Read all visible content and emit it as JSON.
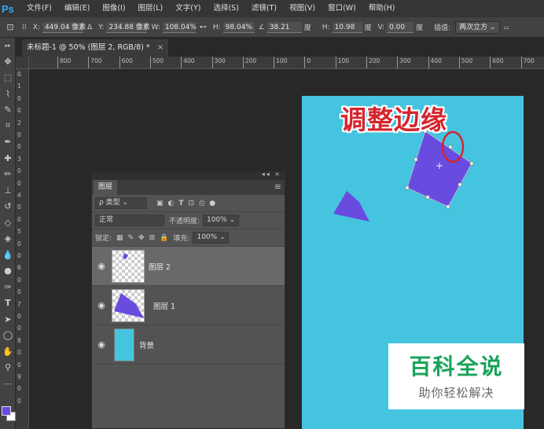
{
  "app": {
    "logo": "Ps"
  },
  "menu": [
    "文件(F)",
    "编辑(E)",
    "图像(I)",
    "图层(L)",
    "文字(Y)",
    "选择(S)",
    "滤镜(T)",
    "视图(V)",
    "窗口(W)",
    "帮助(H)"
  ],
  "options": {
    "x_label": "X:",
    "x_value": "449.04 像素",
    "y_label": "Y:",
    "y_value": "234.88 像素",
    "w_label": "W:",
    "w_value": "108.04%",
    "h_label": "H:",
    "h_value": "98.04%",
    "angle_value": "38.21",
    "angle_unit": "度",
    "hskew_label": "H:",
    "hskew_value": "10.98",
    "hskew_unit": "度",
    "vskew_label": "V:",
    "vskew_value": "0.00",
    "vskew_unit": "度",
    "interp_label": "插值:",
    "interp_value": "两次立方"
  },
  "document_tab": {
    "title": "未标题-1 @ 50% (图层 2, RGB/8) *",
    "close": "×"
  },
  "ruler_h": [
    "800",
    "700",
    "600",
    "500",
    "400",
    "300",
    "200",
    "100",
    "0",
    "100",
    "200",
    "300",
    "400",
    "500",
    "600",
    "700"
  ],
  "ruler_v": [
    "0",
    "1",
    "0",
    "0",
    "2",
    "0",
    "0",
    "3",
    "0",
    "0",
    "4",
    "0",
    "0",
    "5",
    "0",
    "0",
    "6",
    "0",
    "0",
    "7",
    "0",
    "0",
    "8",
    "0",
    "0",
    "9",
    "0",
    "0"
  ],
  "overlay": {
    "title": "调整边缘"
  },
  "watermark": {
    "brand": "百科全说",
    "slogan": "助你轻松解决"
  },
  "layers_panel": {
    "collapse": "◂◂ ×",
    "tab": "图层",
    "menu_icon": "≡",
    "filter_kind": "ρ 类型",
    "blend_mode": "正常",
    "opacity_label": "不透明度:",
    "opacity_value": "100%",
    "lock_label": "锁定:",
    "fill_label": "填充:",
    "fill_value": "100%",
    "layers": [
      {
        "name": "图层 2",
        "selected": true
      },
      {
        "name": "图层 1",
        "selected": false
      },
      {
        "name": "背景",
        "selected": false
      }
    ]
  },
  "colors": {
    "foreground": "#6a4be0",
    "background": "#ffffff",
    "canvas": "#45c4e0",
    "shape": "#6a4be0",
    "highlight": "#d6242d"
  }
}
